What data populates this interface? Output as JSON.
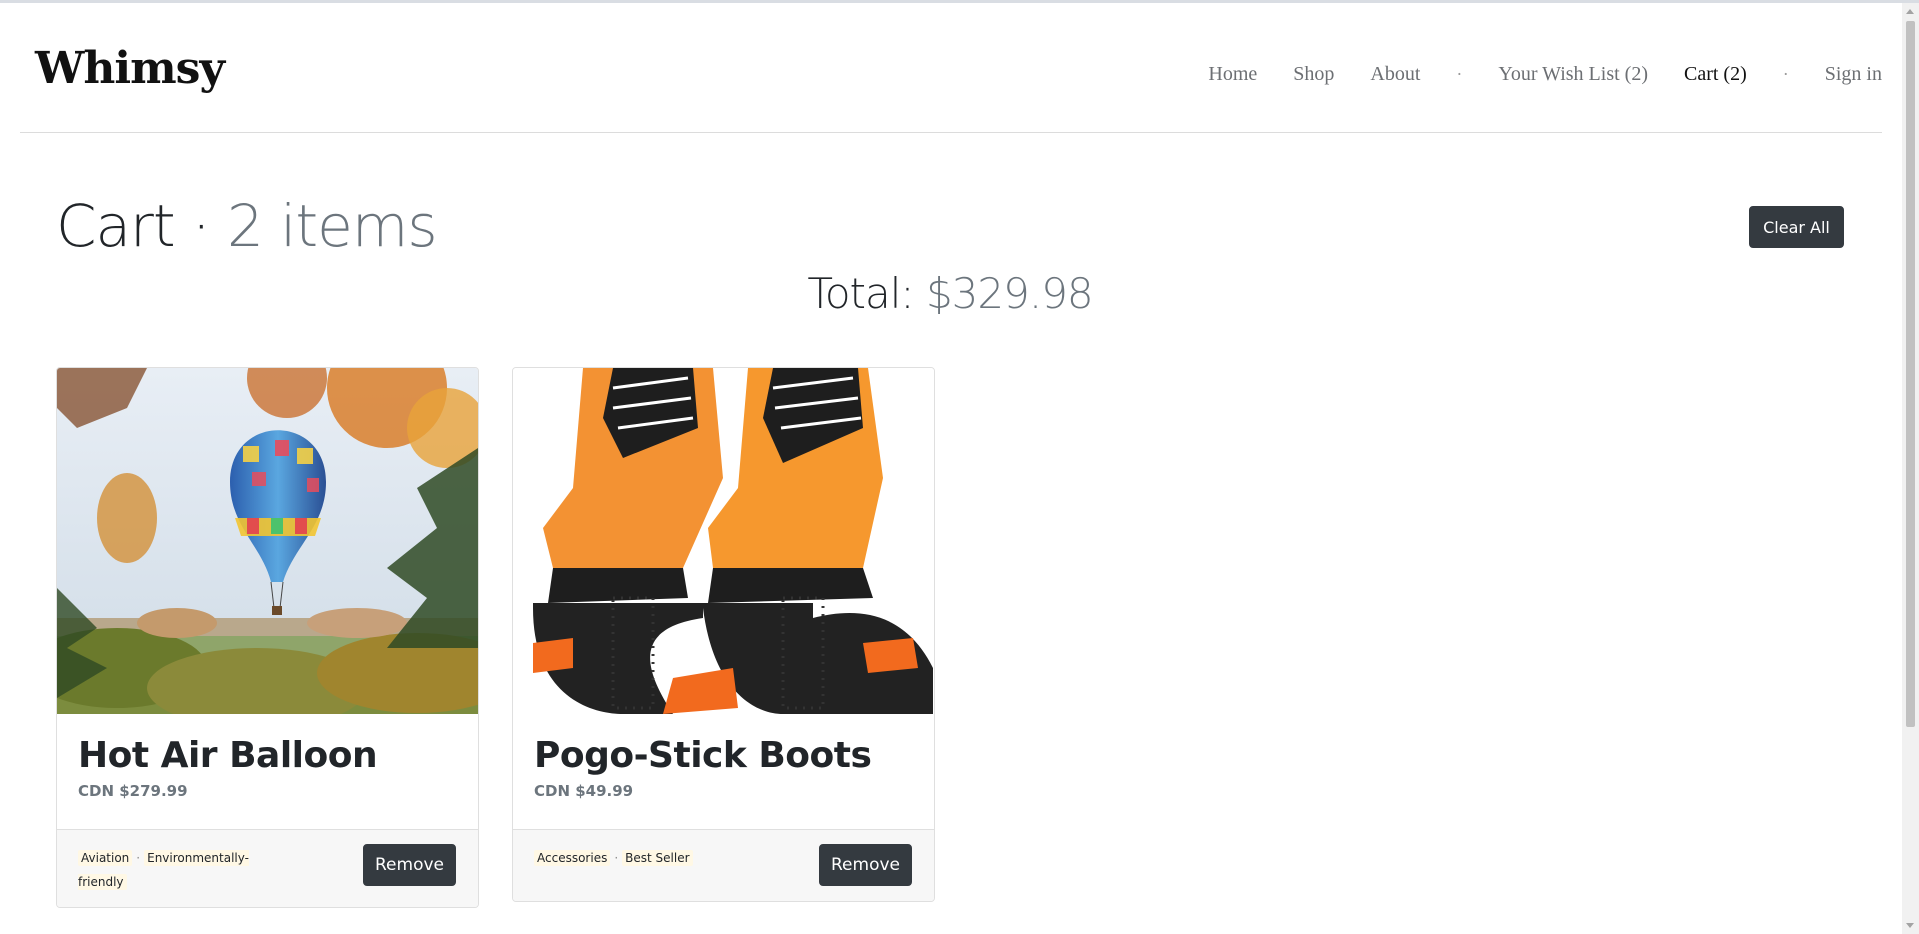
{
  "header": {
    "brand": "Whimsy",
    "nav": [
      {
        "label": "Home"
      },
      {
        "label": "Shop"
      },
      {
        "label": "About"
      },
      {
        "label": "Your Wish List (2)"
      },
      {
        "label": "Cart (2)"
      },
      {
        "label": "Sign in"
      }
    ],
    "separator": "·",
    "active_item": "Cart (2)"
  },
  "cart": {
    "title": "Cart",
    "title_separator": " · ",
    "item_count": "2 items",
    "clear_label": "Clear All",
    "total_label": "Total:",
    "total_value": "$329.98"
  },
  "products": [
    {
      "name": "Hot Air Balloon",
      "price": "CDN $279.99",
      "tags": [
        "Aviation",
        "Environmentally-friendly"
      ],
      "tag_separator": "·",
      "remove_label": "Remove"
    },
    {
      "name": "Pogo-Stick Boots",
      "price": "CDN $49.99",
      "tags": [
        "Accessories",
        "Best Seller"
      ],
      "tag_separator": "·",
      "remove_label": "Remove"
    }
  ],
  "colors": {
    "button_dark": "#343a40",
    "muted_text": "#6c757d",
    "tag_highlight": "#fff8e5",
    "card_footer": "#f7f7f7"
  }
}
